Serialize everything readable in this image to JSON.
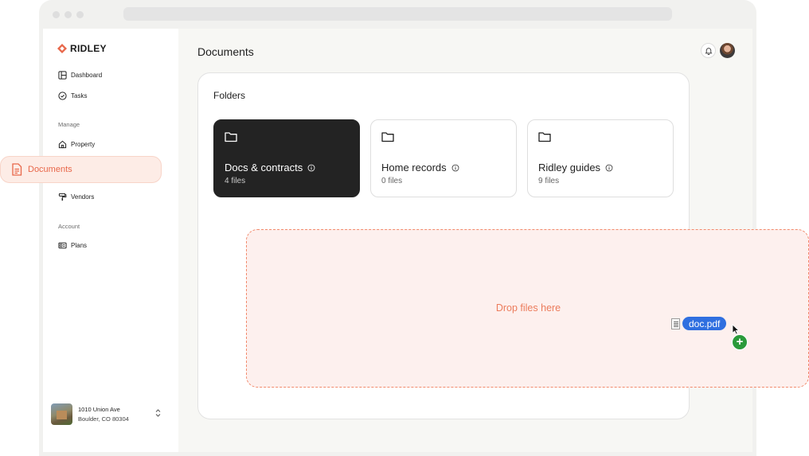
{
  "brand": {
    "name": "RIDLEY",
    "accent": "#e8674a"
  },
  "sidebar": {
    "primary": [
      {
        "label": "Dashboard",
        "icon": "dashboard-icon"
      },
      {
        "label": "Tasks",
        "icon": "check-circle-icon"
      }
    ],
    "manage_label": "Manage",
    "manage": [
      {
        "label": "Property",
        "icon": "home-icon"
      },
      {
        "label": "Documents",
        "icon": "document-icon",
        "active": true
      },
      {
        "label": "Vendors",
        "icon": "paint-roller-icon"
      }
    ],
    "account_label": "Account",
    "account": [
      {
        "label": "Plans",
        "icon": "id-card-icon"
      }
    ],
    "address": {
      "line1": "1010 Union Ave",
      "line2": "Boulder, CO 80304"
    }
  },
  "header": {
    "title": "Documents"
  },
  "folders": {
    "title": "Folders",
    "items": [
      {
        "name": "Docs & contracts",
        "count": "4 files",
        "selected": true
      },
      {
        "name": "Home records",
        "count": "0 files",
        "selected": false
      },
      {
        "name": "Ridley guides",
        "count": "9 files",
        "selected": false
      }
    ]
  },
  "dropzone": {
    "text": "Drop files here"
  },
  "drag": {
    "file_name": "doc.pdf",
    "chip_color": "#2f6fe0",
    "add_color": "#2a9a3a"
  }
}
